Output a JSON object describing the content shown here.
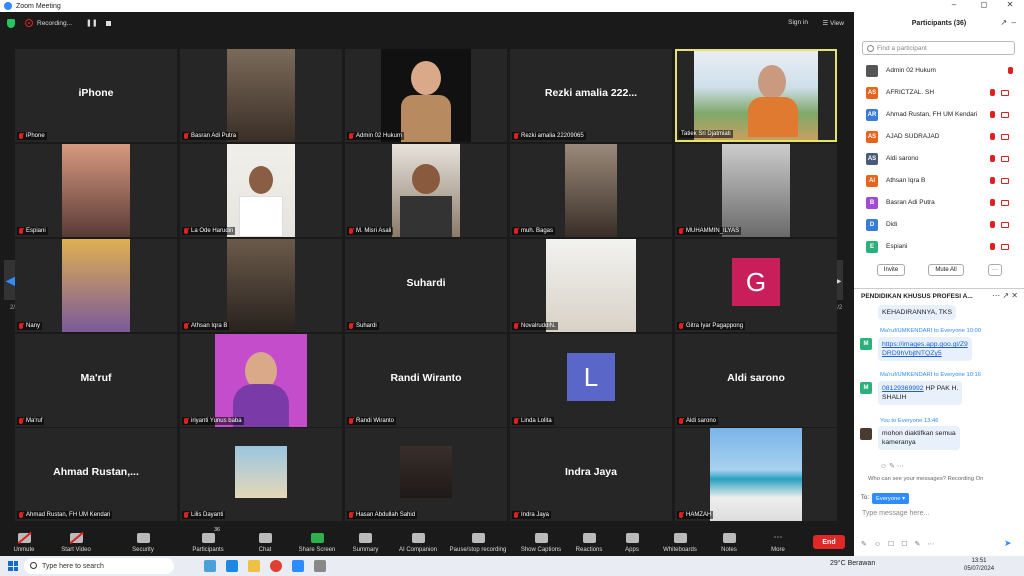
{
  "window": {
    "title": "Zoom Meeting"
  },
  "topbar": {
    "recording": "Recording...",
    "signin": "Sign in",
    "view": "View"
  },
  "tiles": [
    {
      "big": "iPhone",
      "name": "iPhone"
    },
    {
      "big": "",
      "name": "Basran Adi Putra"
    },
    {
      "big": "",
      "name": "Admin 02 Hukum"
    },
    {
      "big": "Rezki amalia 222...",
      "name": "Rezki amalia 22209065"
    },
    {
      "big": "",
      "name": "Tatiek Sri Djatmiati"
    },
    {
      "big": "",
      "name": "Espiani"
    },
    {
      "big": "",
      "name": "La Ode Harudin"
    },
    {
      "big": "",
      "name": "M. Misri Asali"
    },
    {
      "big": "",
      "name": "muh. Bagas"
    },
    {
      "big": "",
      "name": "MUHAMMIN_ILYAS"
    },
    {
      "big": "",
      "name": "Nany"
    },
    {
      "big": "",
      "name": "Athsan Iqra B"
    },
    {
      "big": "Suhardi",
      "name": "Suhardi"
    },
    {
      "big": "",
      "name": "NovalruddiN."
    },
    {
      "big": "",
      "name": "Gitra Iyar Pagappong"
    },
    {
      "big": "Ma'ruf",
      "name": "Ma'ruf"
    },
    {
      "big": "",
      "name": "iriyanti Yunus baba"
    },
    {
      "big": "Randi Wiranto",
      "name": "Randi Wiranto"
    },
    {
      "big": "",
      "name": "Linda Lolita"
    },
    {
      "big": "Aldi sarono",
      "name": "Aldi sarono"
    },
    {
      "big": "Ahmad  Rustan,...",
      "name": "Ahmad Rustan, FH UM Kendari"
    },
    {
      "big": "",
      "name": "Lilis Dayanti"
    },
    {
      "big": "",
      "name": "Hasan Abdullah Sahid"
    },
    {
      "big": "Indra Jaya",
      "name": "Indra Jaya"
    },
    {
      "big": "",
      "name": "HAMZAH"
    }
  ],
  "avatars": {
    "gitra": "G",
    "linda": "L"
  },
  "pager": {
    "left": "2/2",
    "right": "2/2"
  },
  "toolbar": {
    "unmute": "Unmute",
    "start_video": "Start Video",
    "security": "Security",
    "participants": "Participants",
    "participants_count": "36",
    "chat": "Chat",
    "share": "Share Screen",
    "summary": "Summary",
    "ai": "AI Companion",
    "record": "Pause/stop recording",
    "captions": "Show Captions",
    "reactions": "Reactions",
    "apps": "Apps",
    "whiteboards": "Whiteboards",
    "notes": "Notes",
    "more": "More",
    "end": "End"
  },
  "participants_panel": {
    "title": "Participants (36)",
    "search_placeholder": "Find a participant",
    "list": [
      {
        "initials": "",
        "name": "Admin 02 Hukum",
        "color": "#555555"
      },
      {
        "initials": "AS",
        "name": "AFRICTZAL. SH",
        "color": "#e8641a"
      },
      {
        "initials": "AR",
        "name": "Ahmad Rustan, FH UM Kendari",
        "color": "#3a7bd5"
      },
      {
        "initials": "AS",
        "name": "AJAD SUDRAJAD",
        "color": "#e8641a"
      },
      {
        "initials": "AS",
        "name": "Aldi sarono",
        "color": "#4a5a7a"
      },
      {
        "initials": "AI",
        "name": "Athsan Iqra B",
        "color": "#e8641a"
      },
      {
        "initials": "B",
        "name": "Basran Adi Putra",
        "color": "#a24ad8"
      },
      {
        "initials": "D",
        "name": "Didi",
        "color": "#3a7bd5"
      },
      {
        "initials": "E",
        "name": "Espiani",
        "color": "#2bb07c"
      }
    ],
    "invite": "Invite",
    "mute_all": "Mute All",
    "more": "···"
  },
  "chat": {
    "title": "PENDIDIKAN KHUSUS PROFESI A...",
    "partial_message": "KEHADIRANNYA, TKS",
    "messages": [
      {
        "avatar": "M",
        "header": "Ma'ruf/UMKENDARI to Everyone 10:00",
        "link": "https://images.app.goo.gl/Z9DRD9hVbjtNTQZy5",
        "link_line1": "https://images.app.goo.gl/Z9",
        "link_line2": "DRD9hVbjtNTQZy5"
      },
      {
        "avatar": "M",
        "header": "Ma'ruf/UMKENDARI to Everyone 10:16",
        "phone": "08129369992",
        "text1": " HP PAK H.",
        "text2": "SHALIH"
      },
      {
        "header": "You to Everyone 13:46",
        "text1": "mohon diaktifkan semua",
        "text2": "kameranya"
      }
    ],
    "who_can_see": "Who can see your messages? Recording On",
    "to_label": "To:",
    "recipient": "Everyone",
    "input_placeholder": "Type message here..."
  },
  "taskbar": {
    "search_placeholder": "Type here to search",
    "weather": "29°C  Berawan",
    "time": "13:51",
    "date": "05/07/2024"
  }
}
